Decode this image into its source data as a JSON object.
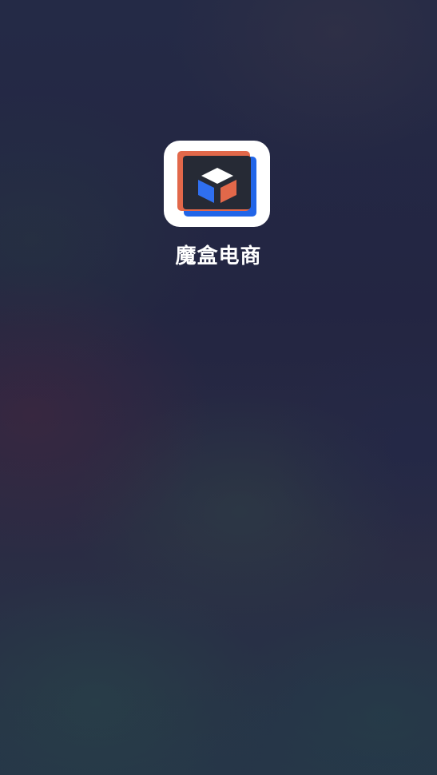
{
  "splash": {
    "app_name": "魔盒电商",
    "icon": "cube-box-icon",
    "colors": {
      "icon_background": "#ffffff",
      "accent_orange": "#e2684a",
      "accent_blue": "#2165e8",
      "icon_inner": "#262a35",
      "text": "#ffffff"
    }
  }
}
